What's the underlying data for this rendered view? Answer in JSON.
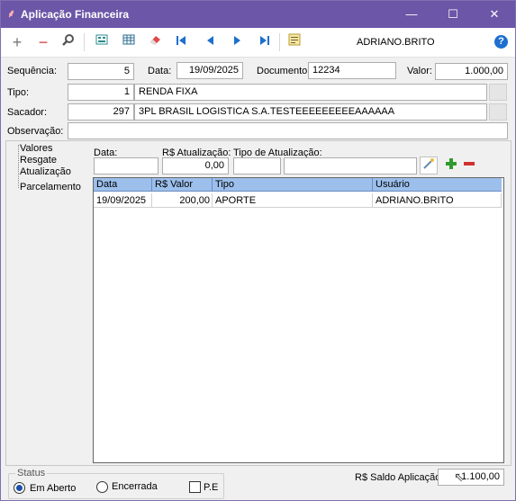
{
  "window": {
    "title": "Aplicação Financeira",
    "minimize": "—",
    "maximize": "☐",
    "close": "✕"
  },
  "toolbar": {
    "user": "ADRIANO.BRITO",
    "help": "?"
  },
  "form": {
    "sequencia_label": "Sequência:",
    "sequencia_value": "5",
    "data_label": "Data:",
    "data_value": "19/09/2025",
    "documento_label": "Documento:",
    "documento_value": "12234",
    "valor_label": "Valor:",
    "valor_value": "1.000,00",
    "tipo_label": "Tipo:",
    "tipo_code": "1",
    "tipo_name": "RENDA FIXA",
    "sacador_label": "Sacador:",
    "sacador_code": "297",
    "sacador_name": "3PL BRASIL LOGISTICA S.A.TESTEEEEEEEEEAAAAAA",
    "observacao_label": "Observação:",
    "observacao_value": ""
  },
  "tree": [
    "Valores",
    "Resgate",
    "Atualização",
    "Parcelamento"
  ],
  "detail": {
    "data_label": "Data:",
    "data_value": "",
    "atualizacao_label": "R$ Atualização:",
    "atualizacao_value": "0,00",
    "tipo_label": "Tipo de Atualização:",
    "tipo_code": "",
    "tipo_name": ""
  },
  "grid": {
    "columns": [
      "Data",
      "R$ Valor",
      "Tipo",
      "Usuário"
    ],
    "rows": [
      [
        "19/09/2025",
        "200,00",
        "APORTE",
        "ADRIANO.BRITO"
      ]
    ]
  },
  "status": {
    "title": "Status",
    "opt1": "Em Aberto",
    "opt2": "Encerrada",
    "opt3": "P.E"
  },
  "saldo": {
    "label": "R$ Saldo Aplicação:",
    "value": "1.100,00"
  },
  "colors": {
    "titlebar": "#6b56a8",
    "grid_header": "#9cbfec",
    "add": "#2e9b2e",
    "remove": "#d23030"
  }
}
